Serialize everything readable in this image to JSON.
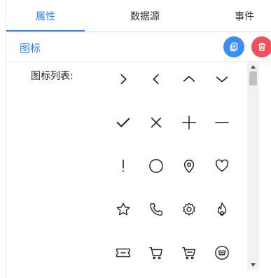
{
  "tabs": [
    {
      "label": "属性",
      "active": true
    },
    {
      "label": "数据源",
      "active": false
    },
    {
      "label": "事件",
      "active": false
    }
  ],
  "section": {
    "title": "图标"
  },
  "icon_list": {
    "label": "图标列表:",
    "rows": [
      [
        "chevron-right-icon",
        "chevron-left-icon",
        "chevron-up-icon",
        "chevron-down-icon"
      ],
      [
        "check-icon",
        "close-icon",
        "plus-icon",
        "minus-icon"
      ],
      [
        "exclamation-icon",
        "circle-icon",
        "location-pin-icon",
        "heart-icon"
      ],
      [
        "star-icon",
        "phone-icon",
        "gear-icon",
        "fire-icon"
      ],
      [
        "ticket-icon",
        "cart-icon",
        "cart-alt-icon",
        "shopping-badge-icon"
      ]
    ]
  },
  "colors": {
    "accent": "#2f7cf5",
    "copy_button": "#3b8cf6",
    "delete_button": "#f2505a"
  }
}
